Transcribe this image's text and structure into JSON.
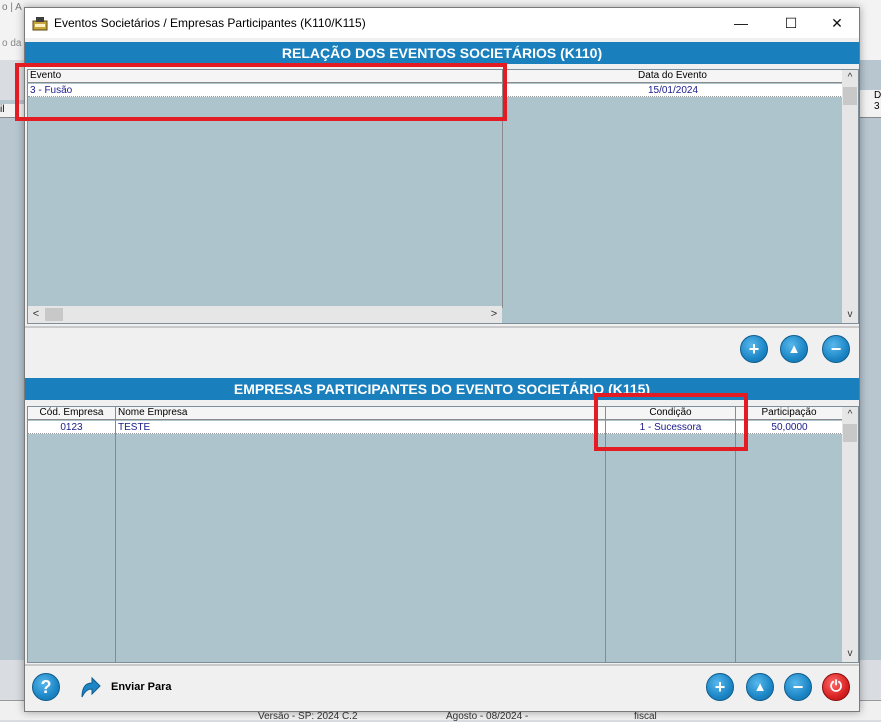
{
  "window": {
    "title": "Eventos Societários / Empresas Participantes (K110/K115)",
    "minimize": "—",
    "maximize": "☐",
    "close": "✕"
  },
  "background": {
    "top_text": "o | A",
    "top_text2": "o da",
    "left_header": "il",
    "right_header": "D",
    "right_cell": "3",
    "bottom": [
      "Versão - SP: 2024 C.2",
      "Agosto - 08/2024 -",
      "fiscal"
    ]
  },
  "k110": {
    "title": "RELAÇÃO DOS EVENTOS SOCIETÁRIOS (K110)",
    "columns": [
      "Evento",
      "Data do Evento"
    ],
    "rows": [
      {
        "evento": "3 - Fusão",
        "data": "15/01/2024"
      }
    ]
  },
  "k115": {
    "title": "EMPRESAS PARTICIPANTES DO EVENTO SOCIETÁRIO (K115)",
    "columns": [
      "Cód. Empresa",
      "Nome Empresa",
      "Condição",
      "Participação"
    ],
    "rows": [
      {
        "cod": "0123",
        "nome": "TESTE",
        "condicao": "1 - Sucessora",
        "participacao": "50,0000"
      }
    ]
  },
  "buttons": {
    "add": "+",
    "up": "▲",
    "remove": "−",
    "help": "?",
    "power": "⏻",
    "send_label": "Enviar Para"
  },
  "colors": {
    "section_bar": "#1a7fbd",
    "grid_bg": "#aec4cd",
    "highlight": "#e31b23"
  }
}
